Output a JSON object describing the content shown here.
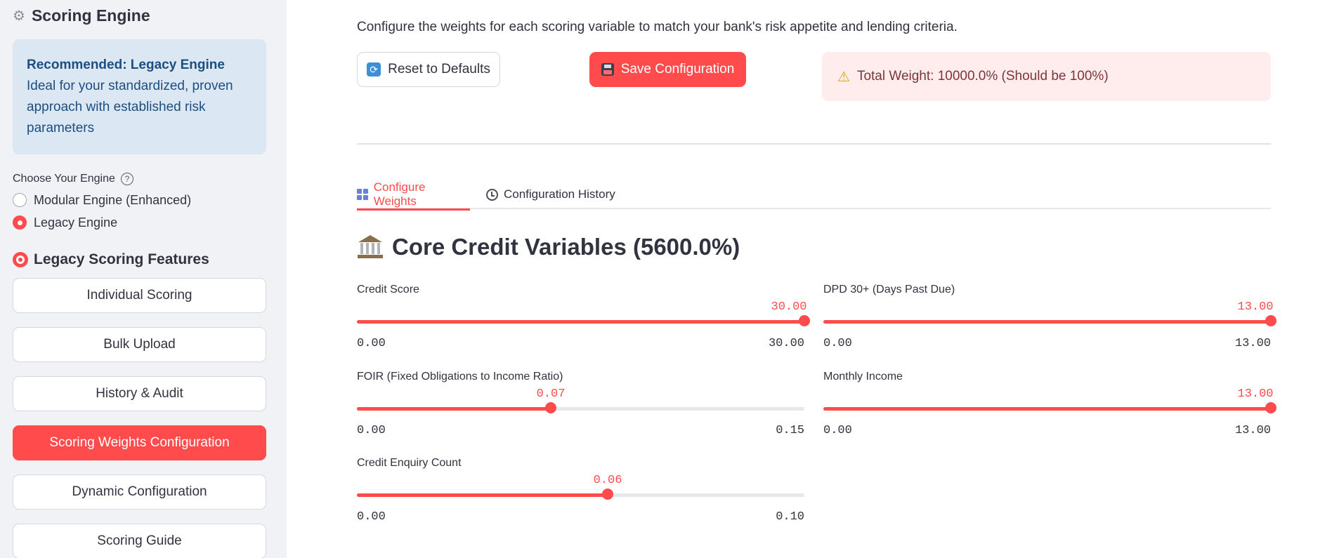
{
  "sidebar": {
    "title": "Scoring Engine",
    "info_strong": "Recommended: Legacy Engine",
    "info_text": " Ideal for your standardized, proven approach with established risk parameters",
    "engine_label": "Choose Your Engine",
    "engine_options": [
      {
        "label": "Modular Engine (Enhanced)",
        "selected": false
      },
      {
        "label": "Legacy Engine",
        "selected": true
      }
    ],
    "features_title": "Legacy Scoring Features",
    "nav": [
      {
        "label": "Individual Scoring",
        "active": false
      },
      {
        "label": "Bulk Upload",
        "active": false
      },
      {
        "label": "History & Audit",
        "active": false
      },
      {
        "label": "Scoring Weights Configuration",
        "active": true
      },
      {
        "label": "Dynamic Configuration",
        "active": false
      },
      {
        "label": "Scoring Guide",
        "active": false
      }
    ]
  },
  "main": {
    "intro": "Configure the weights for each scoring variable to match your bank's risk appetite and lending criteria.",
    "reset_label": "Reset to Defaults",
    "save_label": "Save Configuration",
    "warning": "Total Weight: 10000.0% (Should be 100%)",
    "tabs": [
      {
        "label": "Configure Weights",
        "active": true
      },
      {
        "label": "Configuration History",
        "active": false
      }
    ],
    "section_title": "Core Credit Variables (5600.0%)",
    "sliders": [
      {
        "label": "Credit Score",
        "value": "30.00",
        "min": "0.00",
        "max": "30.00",
        "fraction": 1.0
      },
      {
        "label": "DPD 30+ (Days Past Due)",
        "value": "13.00",
        "min": "0.00",
        "max": "13.00",
        "fraction": 1.0
      },
      {
        "label": "FOIR (Fixed Obligations to Income Ratio)",
        "value": "0.07",
        "min": "0.00",
        "max": "0.15",
        "fraction": 0.433
      },
      {
        "label": "Monthly Income",
        "value": "13.00",
        "min": "0.00",
        "max": "13.00",
        "fraction": 1.0
      },
      {
        "label": "Credit Enquiry Count",
        "value": "0.06",
        "min": "0.00",
        "max": "0.10",
        "fraction": 0.56
      }
    ]
  },
  "colors": {
    "accent": "#ff4b4b",
    "sidebar_bg": "#f0f2f6",
    "info_bg": "#dbe7f3",
    "warning_bg": "#ffecec"
  }
}
